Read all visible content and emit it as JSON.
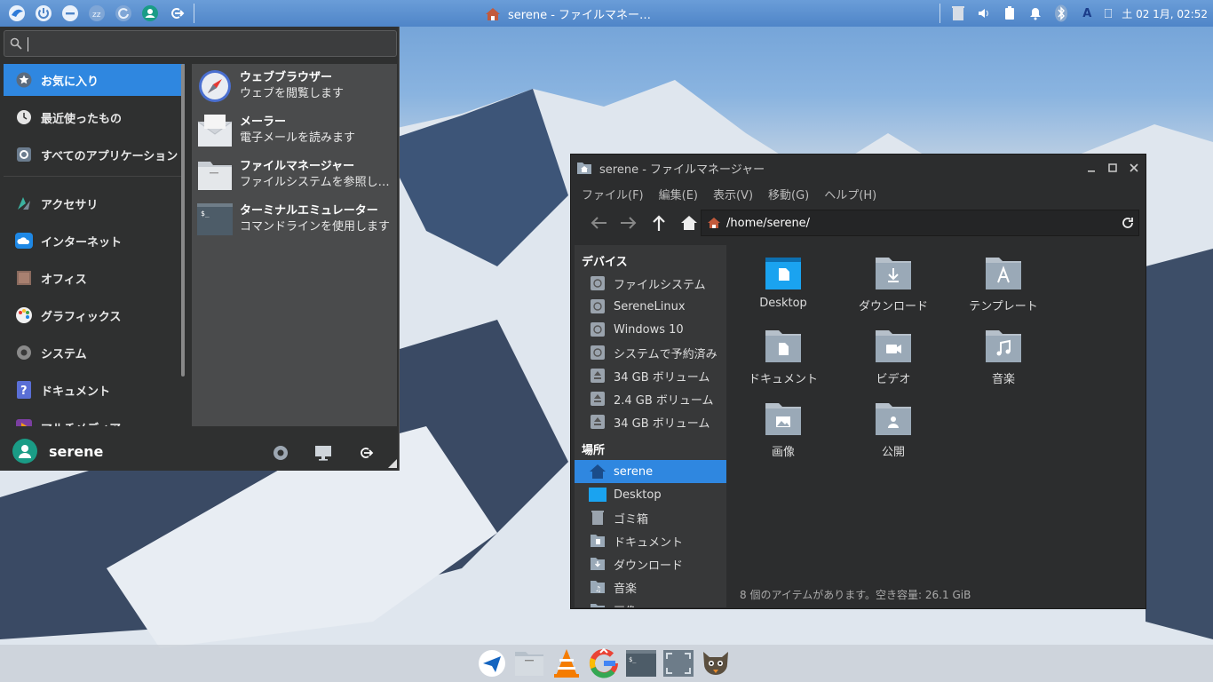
{
  "top_panel": {
    "task_title": "serene - ファイルマネー…",
    "clock": "土 02 1月, 02:52",
    "keyboard_layout": "A"
  },
  "menu": {
    "search_placeholder": "",
    "categories": [
      {
        "label": "お気に入り",
        "icon": "star-icon",
        "selected": true
      },
      {
        "label": "最近使ったもの",
        "icon": "clock-icon"
      },
      {
        "label": "すべてのアプリケーション",
        "icon": "gear-icon"
      },
      {
        "label": "アクセサリ",
        "icon": "accessories-icon"
      },
      {
        "label": "インターネット",
        "icon": "cloud-icon"
      },
      {
        "label": "オフィス",
        "icon": "office-icon"
      },
      {
        "label": "グラフィックス",
        "icon": "palette-icon"
      },
      {
        "label": "システム",
        "icon": "system-gear-icon"
      },
      {
        "label": "ドキュメント",
        "icon": "help-icon"
      },
      {
        "label": "マルチメディア",
        "icon": "multimedia-icon"
      }
    ],
    "apps": [
      {
        "name": "ウェブブラウザー",
        "desc": "ウェブを閲覧します",
        "icon": "compass-icon"
      },
      {
        "name": "メーラー",
        "desc": "電子メールを読みます",
        "icon": "mail-icon"
      },
      {
        "name": "ファイルマネージャー",
        "desc": "ファイルシステムを参照し…",
        "icon": "folder-icon"
      },
      {
        "name": "ターミナルエミュレーター",
        "desc": "コマンドラインを使用します",
        "icon": "terminal-icon"
      }
    ],
    "user": "serene"
  },
  "file_manager": {
    "title": "serene - ファイルマネージャー",
    "menus": [
      "ファイル(F)",
      "編集(E)",
      "表示(V)",
      "移動(G)",
      "ヘルプ(H)"
    ],
    "path": "/home/serene/",
    "devices_header": "デバイス",
    "devices": [
      "ファイルシステム",
      "SereneLinux",
      "Windows 10",
      "システムで予約済み",
      "34 GB ボリューム",
      "2.4 GB ボリューム",
      "34 GB ボリューム"
    ],
    "places_header": "場所",
    "places": [
      "serene",
      "Desktop",
      "ゴミ箱",
      "ドキュメント",
      "ダウンロード",
      "音楽",
      "画像"
    ],
    "items": [
      "Desktop",
      "ダウンロード",
      "テンプレート",
      "ドキュメント",
      "ビデオ",
      "音楽",
      "画像",
      "公開"
    ],
    "status": "8 個のアイテムがあります。空き容量: 26.1 GiB"
  },
  "dock": [
    "send-icon",
    "files-icon",
    "vlc-icon",
    "google-icon",
    "terminal-icon",
    "screenshot-icon",
    "gimp-icon"
  ],
  "colors": {
    "accent": "#2f87e0",
    "panel": "#5a8fd0",
    "folder": "#9aa9b7"
  }
}
